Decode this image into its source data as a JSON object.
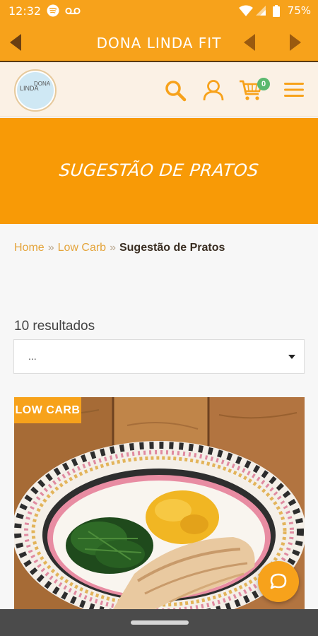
{
  "status_bar": {
    "time": "12:32",
    "battery": "75%",
    "icons": [
      "spotify-icon",
      "voicemail-icon",
      "wifi-icon",
      "signal-icon",
      "battery-icon"
    ]
  },
  "app_bar": {
    "title": "DONA LINDA FIT",
    "icons": [
      "back-arrow-icon",
      "prev-icon",
      "next-icon"
    ]
  },
  "site_header": {
    "logo_text_1": "LINDA",
    "logo_text_2": "DONA",
    "cart_count": "0",
    "icons": [
      "search-icon",
      "user-icon",
      "cart-icon",
      "menu-icon"
    ]
  },
  "banner": {
    "title": "SUGESTÃO DE PRATOS"
  },
  "breadcrumb": {
    "home": "Home",
    "separator": "»",
    "category": "Low Carb",
    "current": "Sugestão de Pratos"
  },
  "results": {
    "count_text": "10 resultados"
  },
  "sort_select": {
    "value": "..."
  },
  "product": {
    "badge": "LOW CARB"
  },
  "colors": {
    "primary": "#f7a21b",
    "header_bg": "#fbf1e5",
    "banner": "#f89a06",
    "badge_green": "#5bb96f",
    "link": "#e4a43b"
  }
}
